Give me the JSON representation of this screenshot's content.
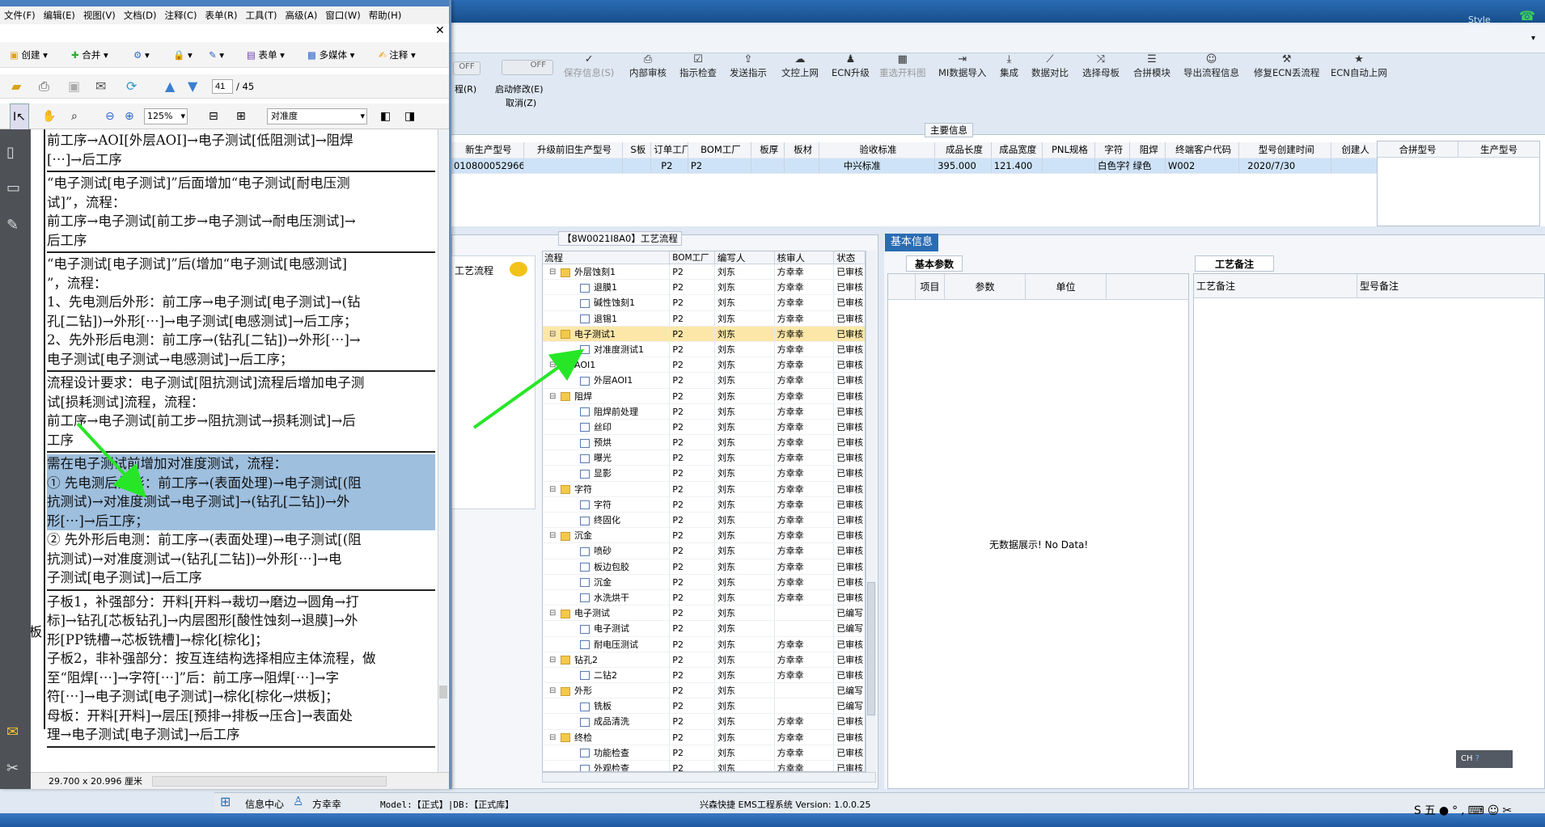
{
  "colors": {
    "header_blue": "#1f5fa5",
    "selection": "#9ebfde",
    "highlight_row": "#fde7a8",
    "green_arrow": "#27e627"
  },
  "pdf": {
    "menu": [
      "文件(F)",
      "编辑(E)",
      "视图(V)",
      "文档(D)",
      "注释(C)",
      "表单(R)",
      "工具(T)",
      "高级(A)",
      "窗口(W)",
      "帮助(H)"
    ],
    "toolbar1": {
      "create": "创建",
      "combine": "合并",
      "form": "表单",
      "multimedia": "多媒体",
      "comment": "注释"
    },
    "page_current": "41",
    "page_total": "/ 45",
    "zoom": "125%",
    "view_mode": "对准度",
    "doc_lines": [
      [
        "前工序→AOI[外层AOI]→电子测试[低阻测试]→阻焊",
        "[⋯]→后工序"
      ],
      [
        "“电子测试[电子测试]”后面增加“电子测试[耐电压测",
        "试]”，流程：",
        "前工序→电子测试[前工步→电子测试→耐电压测试]→",
        "后工序"
      ],
      [
        "“电子测试[电子测试]”后(增加“电子测试[电感测试]",
        "”，流程：",
        "1、先电测后外形：前工序→电子测试[电子测试]→(钻",
        "孔[二钻])→外形[⋯]→电子测试[电感测试]→后工序；",
        "2、先外形后电测：前工序→(钻孔[二钻])→外形[⋯]→",
        "电子测试[电子测试→电感测试]→后工序；"
      ],
      [
        "流程设计要求：电子测试[阻抗测试]流程后增加电子测",
        "试[损耗测试]流程，流程：",
        "前工序→电子测试[前工步→阻抗测试→损耗测试]→后",
        "工序"
      ],
      [
        "需在电子测试前增加对准度测试，流程：",
        "① 先电测后外形：前工序→(表面处理)→电子测试[(阻",
        "抗测试)→对准度测试→电子测试]→(钻孔[二钻])→外",
        "形[⋯]→后工序；",
        "② 先外形后电测：前工序→(表面处理)→电子测试[(阻",
        "抗测试)→对准度测试→(钻孔[二钻])→外形[⋯]→电",
        "子测试[电子测试]→后工序"
      ],
      [
        "子板1，补强部分：开料[开料→裁切→磨边→圆角→打",
        "标]→钻孔[芯板钻孔]→内层图形[酸性蚀刻→退膜]→外",
        "形[PP铣槽→芯板铣槽]→棕化[棕化]；",
        "子板2，非补强部分：按互连结构选择相应主体流程，做",
        "至“阻焊[⋯]→字符[⋯]”后：前工序→阻焊[⋯]→字",
        "符[⋯]→电子测试[电子测试]→棕化[棕化→烘板]；",
        "母板：开料[开料]→层压[预排→排板→压合]→表面处",
        "理→电子测试[电子测试]→后工序"
      ]
    ],
    "left_margin_char": "板",
    "page_size": "29.700 x 20.996 厘米"
  },
  "app": {
    "style_label": "Style",
    "toggle1": "OFF",
    "toggle2": "OFF",
    "toggle1_label": "程(R)",
    "toggle2_label": "启动修改(E)",
    "toggle2_sub": "取消(Z)",
    "toolbar": [
      "保存信息(S)",
      "内部审核",
      "指示检查",
      "发送指示",
      "文控上网",
      "ECN升级",
      "重选开料图",
      "MI数据导入",
      "集成",
      "数据对比",
      "选择母板",
      "合拼模块",
      "导出流程信息",
      "修复ECN丢流程",
      "ECN自动上网"
    ],
    "main_info_title": "主要信息",
    "main_cols": [
      "新生产型号",
      "升级前旧生产型号",
      "S板",
      "订单工厂",
      "BOM工厂",
      "板厚",
      "板材",
      "验收标准",
      "成品长度",
      "成品宽度",
      "PNL规格",
      "字符",
      "阻焊",
      "终端客户代码",
      "型号创建时间",
      "创建人"
    ],
    "main_row": [
      "010800052966",
      "",
      "",
      "P2",
      "P2",
      "",
      "",
      "中兴标准",
      "395.000",
      "121.400",
      "",
      "白色字符",
      "绿色",
      "W002",
      "2020/7/30",
      ""
    ],
    "side_cols": [
      "合拼型号",
      "生产型号"
    ],
    "process_title": "【8W0021I8A0】工艺流程",
    "process_side_label": "工艺流程",
    "tree_cols": [
      "流程",
      "BOM工厂",
      "编写人",
      "核审人",
      "状态"
    ],
    "tree": [
      {
        "name": "外层蚀刻1",
        "lvl": 0,
        "f": "P2",
        "w": "刘东",
        "r": "方幸幸",
        "s": "已审核"
      },
      {
        "name": "退膜1",
        "lvl": 1,
        "f": "P2",
        "w": "刘东",
        "r": "方幸幸",
        "s": "已审核"
      },
      {
        "name": "碱性蚀刻1",
        "lvl": 1,
        "f": "P2",
        "w": "刘东",
        "r": "方幸幸",
        "s": "已审核"
      },
      {
        "name": "退锡1",
        "lvl": 1,
        "f": "P2",
        "w": "刘东",
        "r": "方幸幸",
        "s": "已审核"
      },
      {
        "name": "电子测试1",
        "lvl": 0,
        "f": "P2",
        "w": "刘东",
        "r": "方幸幸",
        "s": "已审核",
        "hl": true
      },
      {
        "name": "对准度测试1",
        "lvl": 1,
        "f": "P2",
        "w": "刘东",
        "r": "方幸幸",
        "s": "已审核"
      },
      {
        "name": "AOI1",
        "lvl": 0,
        "f": "P2",
        "w": "刘东",
        "r": "方幸幸",
        "s": "已审核"
      },
      {
        "name": "外层AOI1",
        "lvl": 1,
        "f": "P2",
        "w": "刘东",
        "r": "方幸幸",
        "s": "已审核"
      },
      {
        "name": "阻焊",
        "lvl": 0,
        "f": "P2",
        "w": "刘东",
        "r": "方幸幸",
        "s": "已审核"
      },
      {
        "name": "阻焊前处理",
        "lvl": 1,
        "f": "P2",
        "w": "刘东",
        "r": "方幸幸",
        "s": "已审核"
      },
      {
        "name": "丝印",
        "lvl": 1,
        "f": "P2",
        "w": "刘东",
        "r": "方幸幸",
        "s": "已审核"
      },
      {
        "name": "预烘",
        "lvl": 1,
        "f": "P2",
        "w": "刘东",
        "r": "方幸幸",
        "s": "已审核"
      },
      {
        "name": "曝光",
        "lvl": 1,
        "f": "P2",
        "w": "刘东",
        "r": "方幸幸",
        "s": "已审核"
      },
      {
        "name": "显影",
        "lvl": 1,
        "f": "P2",
        "w": "刘东",
        "r": "方幸幸",
        "s": "已审核"
      },
      {
        "name": "字符",
        "lvl": 0,
        "f": "P2",
        "w": "刘东",
        "r": "方幸幸",
        "s": "已审核"
      },
      {
        "name": "字符",
        "lvl": 1,
        "f": "P2",
        "w": "刘东",
        "r": "方幸幸",
        "s": "已审核"
      },
      {
        "name": "终固化",
        "lvl": 1,
        "f": "P2",
        "w": "刘东",
        "r": "方幸幸",
        "s": "已审核"
      },
      {
        "name": "沉金",
        "lvl": 0,
        "f": "P2",
        "w": "刘东",
        "r": "方幸幸",
        "s": "已审核"
      },
      {
        "name": "喷砂",
        "lvl": 1,
        "f": "P2",
        "w": "刘东",
        "r": "方幸幸",
        "s": "已审核"
      },
      {
        "name": "板边包胶",
        "lvl": 1,
        "f": "P2",
        "w": "刘东",
        "r": "方幸幸",
        "s": "已审核"
      },
      {
        "name": "沉金",
        "lvl": 1,
        "f": "P2",
        "w": "刘东",
        "r": "方幸幸",
        "s": "已审核"
      },
      {
        "name": "水洗烘干",
        "lvl": 1,
        "f": "P2",
        "w": "刘东",
        "r": "方幸幸",
        "s": "已审核"
      },
      {
        "name": "电子测试",
        "lvl": 0,
        "f": "P2",
        "w": "刘东",
        "r": "",
        "s": "已编写"
      },
      {
        "name": "电子测试",
        "lvl": 1,
        "f": "P2",
        "w": "刘东",
        "r": "",
        "s": "已编写"
      },
      {
        "name": "耐电压测试",
        "lvl": 1,
        "f": "P2",
        "w": "刘东",
        "r": "方幸幸",
        "s": "已审核"
      },
      {
        "name": "钻孔2",
        "lvl": 0,
        "f": "P2",
        "w": "刘东",
        "r": "方幸幸",
        "s": "已审核"
      },
      {
        "name": "二钻2",
        "lvl": 1,
        "f": "P2",
        "w": "刘东",
        "r": "方幸幸",
        "s": "已审核"
      },
      {
        "name": "外形",
        "lvl": 0,
        "f": "P2",
        "w": "刘东",
        "r": "",
        "s": "已编写"
      },
      {
        "name": "铣板",
        "lvl": 1,
        "f": "P2",
        "w": "刘东",
        "r": "",
        "s": "已编写"
      },
      {
        "name": "成品清洗",
        "lvl": 1,
        "f": "P2",
        "w": "刘东",
        "r": "方幸幸",
        "s": "已审核"
      },
      {
        "name": "终检",
        "lvl": 0,
        "f": "P2",
        "w": "刘东",
        "r": "方幸幸",
        "s": "已审核"
      },
      {
        "name": "功能检查",
        "lvl": 1,
        "f": "P2",
        "w": "刘东",
        "r": "方幸幸",
        "s": "已审核"
      },
      {
        "name": "外观检查",
        "lvl": 1,
        "f": "P2",
        "w": "刘东",
        "r": "方幸幸",
        "s": "已审核"
      }
    ],
    "basic_info_title": "基本信息",
    "basic_params_tab": "基本参数",
    "param_cols": [
      "项目",
      "参数",
      "单位"
    ],
    "no_data": "无数据展示! No Data!",
    "remark_tab": "工艺备注",
    "remark_cols": [
      "工艺备注",
      "型号备注"
    ],
    "status_bar": {
      "msg_center": "信息中心",
      "user": "方幸幸",
      "model": "Model:【正式】|DB:【正式库】",
      "system": "兴森快捷 EMS工程系统 Version: 1.0.0.25"
    },
    "ime": "CH"
  }
}
